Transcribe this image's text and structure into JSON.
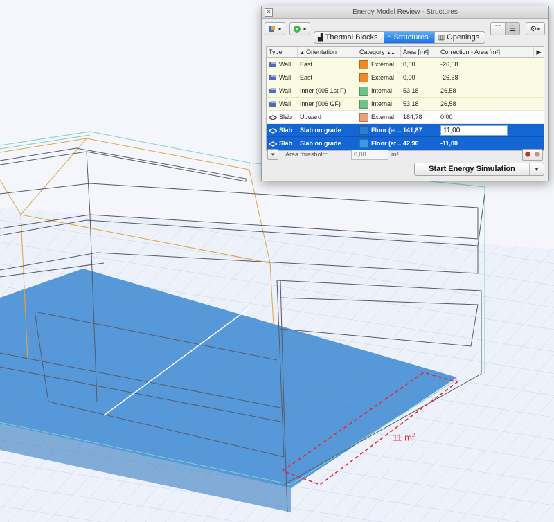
{
  "window": {
    "title": "Energy Model Review - Structures"
  },
  "tabs": [
    {
      "label": "Thermal Blocks",
      "icon": "thermal-blocks-icon",
      "active": false
    },
    {
      "label": "Structures",
      "icon": "structures-icon",
      "active": true
    },
    {
      "label": "Openings",
      "icon": "openings-icon",
      "active": false
    }
  ],
  "table": {
    "headers": {
      "type": "Type",
      "orientation": "Orientation",
      "category": "Category",
      "area": "Area [m²]",
      "correction": "Correction - Area [m²]"
    },
    "rows": [
      {
        "type": "Wall",
        "orientation": "East",
        "category": "External",
        "color": "#f08a24",
        "area": "0,00",
        "correction": "-26,58",
        "style": "yellow"
      },
      {
        "type": "Wall",
        "orientation": "East",
        "category": "External",
        "color": "#f08a24",
        "area": "0,00",
        "correction": "-26,58",
        "style": "yellow"
      },
      {
        "type": "Wall",
        "orientation": "Inner (005 1st F)",
        "category": "Internal",
        "color": "#6cc48a",
        "area": "53,18",
        "correction": "26,58",
        "style": "yellow"
      },
      {
        "type": "Wall",
        "orientation": "Inner (006 GF)",
        "category": "Internal",
        "color": "#6cc48a",
        "area": "53,18",
        "correction": "26,58",
        "style": "yellow"
      },
      {
        "type": "Slab",
        "orientation": "Upward",
        "category": "External",
        "color": "#e8a278",
        "area": "184,78",
        "correction": "0,00",
        "style": "white"
      },
      {
        "type": "Slab",
        "orientation": "Slab on grade",
        "category": "Floor (at...",
        "color": "#2d7fd0",
        "area": "141,87",
        "correction": "11,00",
        "style": "sel",
        "editing": true
      },
      {
        "type": "Slab",
        "orientation": "Slab on grade",
        "category": "Floor (at...",
        "color": "#3a9ae8",
        "area": "42,90",
        "correction": "-11,00",
        "style": "sel"
      }
    ]
  },
  "filter": {
    "label": "Area threshold:",
    "placeholder": "0,00",
    "unit": "m²"
  },
  "actions": {
    "start_label": "Start Energy Simulation"
  },
  "annotation": {
    "text": "11 m",
    "sup": "2"
  },
  "colors": {
    "accent": "#1b72e8",
    "selected_row": "#1466d4",
    "highlight": "#e8262a",
    "floor_fill": "#2d7fd0"
  }
}
